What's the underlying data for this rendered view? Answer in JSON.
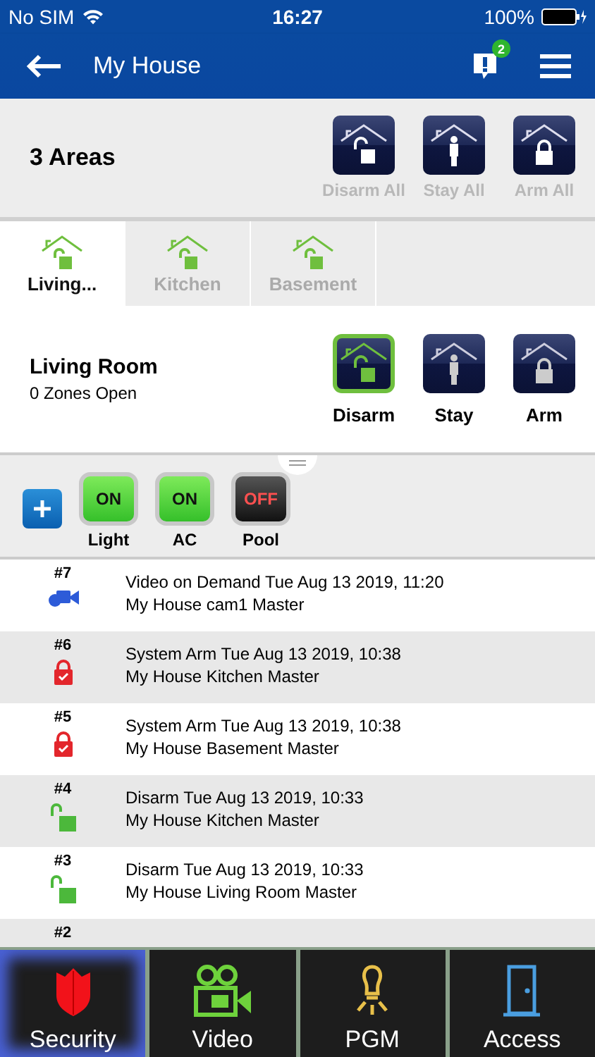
{
  "status_bar": {
    "carrier": "No SIM",
    "time": "16:27",
    "battery": "100%"
  },
  "header": {
    "title": "My House",
    "badge": "2"
  },
  "areas_bar": {
    "title": "3 Areas",
    "actions": [
      {
        "kind": "disarm",
        "label": "Disarm All",
        "disabled": true
      },
      {
        "kind": "stay",
        "label": "Stay All",
        "disabled": true
      },
      {
        "kind": "arm",
        "label": "Arm All",
        "disabled": true
      }
    ]
  },
  "tabs": [
    {
      "label": "Living...",
      "selected": true
    },
    {
      "label": "Kitchen",
      "selected": false
    },
    {
      "label": "Basement",
      "selected": false
    }
  ],
  "area": {
    "name": "Living Room",
    "zones": "0 Zones Open",
    "modes": [
      {
        "kind": "disarm",
        "label": "Disarm",
        "selected": true
      },
      {
        "kind": "stay",
        "label": "Stay",
        "selected": false
      },
      {
        "kind": "arm",
        "label": "Arm",
        "selected": false
      }
    ]
  },
  "switches": [
    {
      "label": "Light",
      "state": "ON",
      "on": true
    },
    {
      "label": "AC",
      "state": "ON",
      "on": true
    },
    {
      "label": "Pool",
      "state": "OFF",
      "on": false
    }
  ],
  "events": [
    {
      "number": "#7",
      "kind": "video",
      "line1": "Video on Demand Tue Aug 13 2019, 11:20",
      "line2": "My House cam1 Master"
    },
    {
      "number": "#6",
      "kind": "arm",
      "line1": "System Arm Tue Aug 13 2019, 10:38",
      "line2": "My House Kitchen Master"
    },
    {
      "number": "#5",
      "kind": "arm",
      "line1": "System Arm Tue Aug 13 2019, 10:38",
      "line2": "My House Basement Master"
    },
    {
      "number": "#4",
      "kind": "disarm",
      "line1": "Disarm Tue Aug 13 2019, 10:33",
      "line2": "My House Kitchen Master"
    },
    {
      "number": "#3",
      "kind": "disarm",
      "line1": "Disarm Tue Aug 13 2019, 10:33",
      "line2": "My House Living Room Master"
    },
    {
      "number": "#2"
    }
  ],
  "bottom_tabs": [
    {
      "kind": "security",
      "label": "Security",
      "selected": true
    },
    {
      "kind": "video",
      "label": "Video",
      "selected": false
    },
    {
      "kind": "pgm",
      "label": "PGM",
      "selected": false
    },
    {
      "kind": "access",
      "label": "Access",
      "selected": false
    }
  ]
}
